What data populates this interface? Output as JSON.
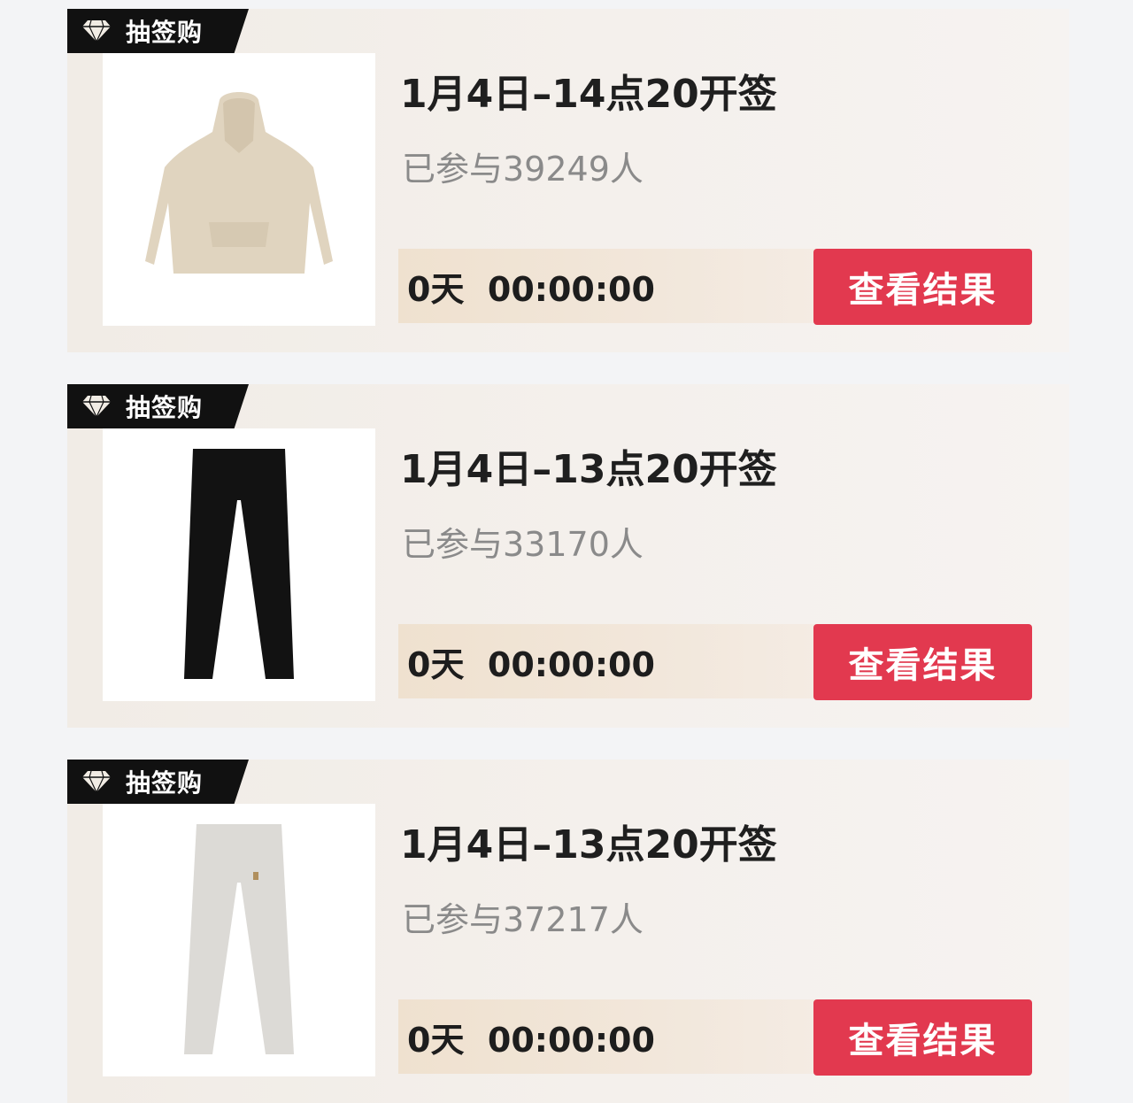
{
  "colors": {
    "badge_bg": "#111111",
    "button_bg": "#e2394f",
    "card_bg": "#f3eee9",
    "timer_bg": "#f0e3d3"
  },
  "items": [
    {
      "badge_label": "抽签购",
      "badge_icon": "diamond-icon",
      "product_image": "beige-hoodie",
      "title": "1月4日–14点20开签",
      "participants": "已参与39249人",
      "countdown": "0天  00:00:00",
      "button_label": "查看结果"
    },
    {
      "badge_label": "抽签购",
      "badge_icon": "diamond-icon",
      "product_image": "black-pants",
      "title": "1月4日–13点20开签",
      "participants": "已参与33170人",
      "countdown": "0天  00:00:00",
      "button_label": "查看结果"
    },
    {
      "badge_label": "抽签购",
      "badge_icon": "diamond-icon",
      "product_image": "light-gray-pants",
      "title": "1月4日–13点20开签",
      "participants": "已参与37217人",
      "countdown": "0天  00:00:00",
      "button_label": "查看结果"
    }
  ]
}
